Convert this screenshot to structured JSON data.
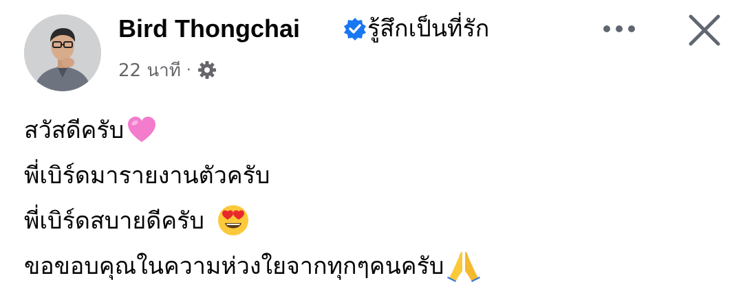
{
  "post": {
    "author": "Bird Thongchai",
    "feeling": "รู้สึกเป็นที่รัก",
    "time": "22 นาที",
    "separator": "·",
    "privacy_icon": "gear-icon",
    "verified_icon": "verified-badge-icon",
    "lines": [
      {
        "text": "สวัสดีครับ",
        "emoji": "pink-heart-emoji"
      },
      {
        "text": "พี่เบิร์ดมารายงานตัวครับ",
        "emoji": ""
      },
      {
        "text": "พี่เบิร์ดสบายดีครับ",
        "emoji": "heart-eyes-emoji"
      },
      {
        "text": "ขอขอบคุณในความห่วงใยจากทุกๆคนครับ",
        "emoji": "folded-hands-emoji"
      }
    ]
  },
  "actions": {
    "more_icon": "more-options-icon",
    "close_icon": "close-icon"
  },
  "colors": {
    "text": "#050505",
    "secondary_text": "#65676b",
    "verified": "#1877f2",
    "icon_gray": "#606770"
  }
}
